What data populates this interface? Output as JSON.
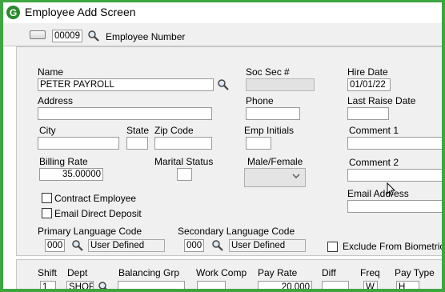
{
  "window": {
    "title": "Employee Add Screen"
  },
  "header": {
    "employee_number": "00009",
    "employee_number_label": "Employee Number"
  },
  "labels": {
    "name": "Name",
    "soc_sec": "Soc Sec #",
    "hire_date": "Hire Date",
    "address": "Address",
    "phone": "Phone",
    "last_raise_date": "Last Raise Date",
    "city": "City",
    "state": "State",
    "zip": "Zip Code",
    "emp_initials": "Emp Initials",
    "comment1": "Comment 1",
    "billing_rate": "Billing Rate",
    "marital_status": "Marital Status",
    "male_female": "Male/Female",
    "comment2": "Comment 2",
    "contract_employee": "Contract Employee",
    "email_direct_deposit": "Email Direct Deposit",
    "email_address": "Email Address",
    "primary_language_code": "Primary Language Code",
    "secondary_language_code": "Secondary Language Code",
    "exclude_biometric": "Exclude From Biometric"
  },
  "values": {
    "name": "PETER PAYROLL",
    "hire_date": "01/01/22",
    "billing_rate": "35.00000",
    "primary_code": "000",
    "primary_desc": "User Defined",
    "secondary_code": "000",
    "secondary_desc": "User Defined"
  },
  "grid": {
    "columns": [
      "Shift",
      "Dept",
      "Balancing Grp",
      "Work Comp",
      "Pay Rate",
      "Diff",
      "Freq",
      "Pay Type"
    ],
    "row": {
      "shift": "1",
      "dept": "SHOP",
      "pay_rate": "20.000",
      "freq": "W",
      "pay_type": "H"
    }
  },
  "colors": {
    "frame": "#3da63f",
    "panel": "#f0f0f0",
    "logo": "#2a8a2e"
  },
  "icons": [
    "app-logo-icon",
    "magnifier-icon",
    "chevron-down-icon",
    "mouse-cursor-icon"
  ]
}
